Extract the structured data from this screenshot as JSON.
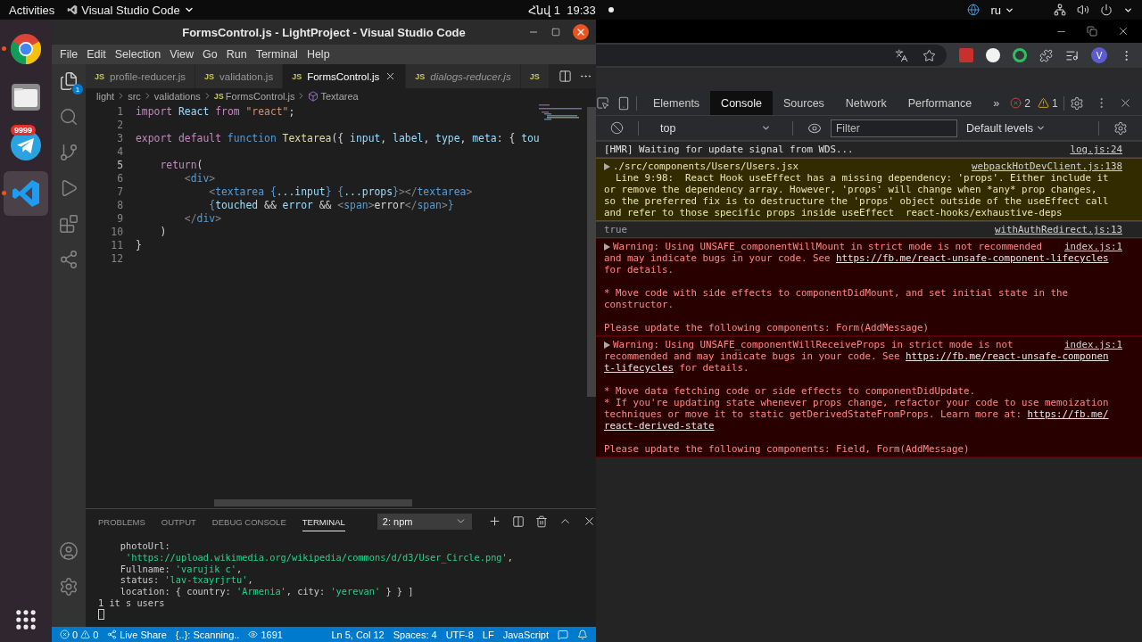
{
  "top_bar": {
    "activities": "Activities",
    "app_menu": "Visual Studio Code",
    "date": "Հնվ 1",
    "time": "19:33",
    "keyboard_layout": "ru"
  },
  "dock": {
    "items": [
      {
        "kind": "chrome",
        "running": true,
        "selected": false
      },
      {
        "kind": "files",
        "running": false,
        "selected": false
      },
      {
        "kind": "telegram",
        "running": false,
        "selected": false,
        "badge": "9999"
      },
      {
        "kind": "vscode",
        "running": true,
        "selected": true
      }
    ]
  },
  "vscode": {
    "title": "FormsControl.js - LightProject - Visual Studio Code",
    "menu": [
      "File",
      "Edit",
      "Selection",
      "View",
      "Go",
      "Run",
      "Terminal",
      "Help"
    ],
    "explorer_badge": "1",
    "tabs": [
      {
        "icon": "JS",
        "label": "profile-reducer.js",
        "selected": false,
        "preview": false
      },
      {
        "icon": "JS",
        "label": "validation.js",
        "selected": false,
        "preview": false
      },
      {
        "icon": "JS",
        "label": "FormsControl.js",
        "selected": true,
        "preview": false
      },
      {
        "icon": "JS",
        "label": "dialogs-reducer.js",
        "selected": false,
        "preview": true
      },
      {
        "icon": "JS",
        "selected": false
      }
    ],
    "breadcrumbs": [
      {
        "kind": "folder",
        "label": "light"
      },
      {
        "kind": "folder",
        "label": "src"
      },
      {
        "kind": "folder",
        "label": "validations"
      },
      {
        "kind": "file",
        "icon": "JS",
        "label": "FormsControl.js"
      },
      {
        "kind": "symbol",
        "label": "Textarea"
      }
    ],
    "code": [
      {
        "n": "1",
        "tokens": [
          {
            "kind": "keyword",
            "text": "import"
          },
          {
            "kind": "variable",
            "text": " React"
          },
          {
            "kind": "keyword",
            "text": " from"
          },
          {
            "kind": "string",
            "text": " \"react\""
          },
          {
            "kind": "plain",
            "text": ";"
          }
        ]
      },
      {
        "n": "2"
      },
      {
        "n": "3",
        "tokens": [
          {
            "kind": "keyword",
            "text": "export default"
          },
          {
            "kind": "storage",
            "text": " function"
          },
          {
            "kind": "function",
            "text": " Textarea"
          },
          {
            "kind": "plain",
            "text": "({ "
          },
          {
            "kind": "variable",
            "text": "input"
          },
          {
            "kind": "plain",
            "text": ", "
          },
          {
            "kind": "variable",
            "text": "label"
          },
          {
            "kind": "plain",
            "text": ", "
          },
          {
            "kind": "variable",
            "text": "type"
          },
          {
            "kind": "plain",
            "text": ", "
          },
          {
            "kind": "variable",
            "text": "meta"
          },
          {
            "kind": "plain",
            "text": ": { "
          },
          {
            "kind": "variable",
            "text": "tou"
          }
        ]
      },
      {
        "n": "4"
      },
      {
        "n": "5",
        "tokens": [
          {
            "kind": "keyword",
            "text": "    return"
          },
          {
            "kind": "plain",
            "text": "("
          }
        ]
      },
      {
        "n": "6",
        "tokens": [
          {
            "kind": "punct",
            "text": "        <"
          },
          {
            "kind": "tag",
            "text": "div"
          },
          {
            "kind": "punct",
            "text": ">"
          }
        ]
      },
      {
        "n": "7",
        "tokens": [
          {
            "kind": "punct",
            "text": "            <"
          },
          {
            "kind": "tag",
            "text": "textarea"
          },
          {
            "kind": "tag",
            "text": " {"
          },
          {
            "kind": "variable",
            "text": "...input"
          },
          {
            "kind": "tag",
            "text": "}"
          },
          {
            "kind": "tag",
            "text": " {"
          },
          {
            "kind": "variable",
            "text": "...props"
          },
          {
            "kind": "tag",
            "text": "}"
          },
          {
            "kind": "punct",
            "text": "></"
          },
          {
            "kind": "tag",
            "text": "textarea"
          },
          {
            "kind": "punct",
            "text": ">"
          }
        ]
      },
      {
        "n": "8",
        "tokens": [
          {
            "kind": "tag",
            "text": "            {"
          },
          {
            "kind": "variable",
            "text": "touched"
          },
          {
            "kind": "plain",
            "text": " && "
          },
          {
            "kind": "variable",
            "text": "error"
          },
          {
            "kind": "plain",
            "text": " && "
          },
          {
            "kind": "punct",
            "text": "<"
          },
          {
            "kind": "tag",
            "text": "span"
          },
          {
            "kind": "punct",
            "text": ">"
          },
          {
            "kind": "plain",
            "text": "error"
          },
          {
            "kind": "punct",
            "text": "</"
          },
          {
            "kind": "tag",
            "text": "span"
          },
          {
            "kind": "punct",
            "text": ">"
          },
          {
            "kind": "tag",
            "text": "}"
          }
        ]
      },
      {
        "n": "9",
        "tokens": [
          {
            "kind": "punct",
            "text": "        </"
          },
          {
            "kind": "tag",
            "text": "div"
          },
          {
            "kind": "punct",
            "text": ">"
          }
        ]
      },
      {
        "n": "10",
        "tokens": [
          {
            "kind": "plain",
            "text": "    )"
          }
        ]
      },
      {
        "n": "11",
        "tokens": [
          {
            "kind": "plain",
            "text": "}"
          }
        ]
      },
      {
        "n": "12"
      }
    ],
    "panel_tabs": [
      {
        "label": "PROBLEMS",
        "selected": false
      },
      {
        "label": "OUTPUT",
        "selected": false
      },
      {
        "label": "DEBUG CONSOLE",
        "selected": false
      },
      {
        "label": "TERMINAL",
        "selected": true
      }
    ],
    "terminal_select": "2: npm",
    "terminal": [
      [
        {
          "kind": "plain",
          "text": "    photoUrl:"
        }
      ],
      [
        {
          "kind": "string",
          "text": "     'https://upload.wikimedia.org/wikipedia/commons/d/d3/User_Circle.png'"
        },
        {
          "kind": "plain",
          "text": ","
        }
      ],
      [
        {
          "kind": "plain",
          "text": "    Fullname: "
        },
        {
          "kind": "string",
          "text": "'varujik c'"
        },
        {
          "kind": "plain",
          "text": ","
        }
      ],
      [
        {
          "kind": "plain",
          "text": "    status: "
        },
        {
          "kind": "string",
          "text": "'lav-txayrjrtu'"
        },
        {
          "kind": "plain",
          "text": ","
        }
      ],
      [
        {
          "kind": "plain",
          "text": "    location: { country: "
        },
        {
          "kind": "string",
          "text": "'Armenia'"
        },
        {
          "kind": "plain",
          "text": ", city: "
        },
        {
          "kind": "string",
          "text": "'yerevan'"
        },
        {
          "kind": "plain",
          "text": " } } ]"
        }
      ],
      [
        {
          "kind": "plain",
          "text": "1 it s users"
        }
      ]
    ],
    "status_bar": {
      "errors": "0",
      "warnings": "0",
      "live_share": "Live Share",
      "scanning": "{..}: Scanning..",
      "watchers": "1691",
      "right": [
        "Ln 5, Col 12",
        "Spaces: 4",
        "UTF-8",
        "LF",
        "JavaScript"
      ]
    }
  },
  "chrome": {
    "avatar": "V",
    "devtools": {
      "tabs": [
        {
          "label": "Elements",
          "selected": false
        },
        {
          "label": "Console",
          "selected": true
        },
        {
          "label": "Sources",
          "selected": false
        },
        {
          "label": "Network",
          "selected": false
        },
        {
          "label": "Performance",
          "selected": false
        }
      ],
      "more": "»",
      "errors": "2",
      "warnings": "1",
      "context": "top",
      "filter_placeholder": "Filter",
      "levels": "Default levels"
    },
    "console": [
      {
        "kind": "info",
        "expandable": false,
        "source": "log.js:24",
        "paragraphs": [
          [
            [
              {
                "kind": "text",
                "text": "[HMR] Waiting for update signal from WDS..."
              }
            ]
          ]
        ]
      },
      {
        "kind": "warning",
        "expandable": true,
        "source": "webpackHotDevClient.js:138",
        "paragraphs": [
          [
            [
              {
                "kind": "text",
                "text": "./src/components/Users/Users.jsx"
              }
            ],
            [
              {
                "kind": "text",
                "text": "  Line 9:98:  React Hook useEffect has a missing dependency: 'props'. Either include it"
              }
            ],
            [
              {
                "kind": "text",
                "text": "or remove the dependency array. However, 'props' will change when *any* prop changes,"
              }
            ],
            [
              {
                "kind": "text",
                "text": "so the preferred fix is to destructure the 'props' object outside of the useEffect call"
              }
            ],
            [
              {
                "kind": "text",
                "text": "and refer to those specific props inside useEffect  react-hooks/exhaustive-deps"
              }
            ]
          ]
        ]
      },
      {
        "kind": "log",
        "expandable": false,
        "source": "withAuthRedirect.js:13",
        "paragraphs": [
          [
            [
              {
                "kind": "text",
                "text": "true"
              }
            ]
          ]
        ]
      },
      {
        "kind": "error",
        "expandable": true,
        "source": "index.js:1",
        "paragraphs": [
          [
            [
              {
                "kind": "text",
                "text": "Warning: Using UNSAFE_componentWillMount in strict mode is not recommended"
              }
            ],
            [
              {
                "kind": "text",
                "text": "and may indicate bugs in your code. See "
              },
              {
                "kind": "link",
                "text": "https://fb.me/react-unsafe-component-lifecycles"
              }
            ],
            [
              {
                "kind": "text",
                "text": "for details."
              }
            ]
          ],
          [
            [
              {
                "kind": "text",
                "text": "* Move code with side effects to componentDidMount, and set initial state in the"
              }
            ],
            [
              {
                "kind": "text",
                "text": "constructor."
              }
            ]
          ],
          [
            [
              {
                "kind": "text",
                "text": "Please update the following components: Form(AddMessage)"
              }
            ]
          ]
        ]
      },
      {
        "kind": "error",
        "expandable": true,
        "source": "index.js:1",
        "paragraphs": [
          [
            [
              {
                "kind": "text",
                "text": "Warning: Using UNSAFE_componentWillReceiveProps in strict mode is not"
              }
            ],
            [
              {
                "kind": "text",
                "text": "recommended and may indicate bugs in your code. See "
              },
              {
                "kind": "link",
                "text": "https://fb.me/react-unsafe-componen"
              }
            ],
            [
              {
                "kind": "link",
                "text": "t-lifecycles"
              },
              {
                "kind": "text",
                "text": " for details."
              }
            ]
          ],
          [
            [
              {
                "kind": "text",
                "text": "* Move data fetching code or side effects to componentDidUpdate."
              }
            ],
            [
              {
                "kind": "text",
                "text": "* If you're updating state whenever props change, refactor your code to use memoization"
              }
            ],
            [
              {
                "kind": "text",
                "text": "techniques or move it to static getDerivedStateFromProps. Learn more at: "
              },
              {
                "kind": "link",
                "text": "https://fb.me/"
              }
            ],
            [
              {
                "kind": "link",
                "text": "react-derived-state"
              }
            ]
          ],
          [
            [
              {
                "kind": "text",
                "text": "Please update the following components: Field, Form(AddMessage)"
              }
            ]
          ]
        ]
      }
    ]
  }
}
